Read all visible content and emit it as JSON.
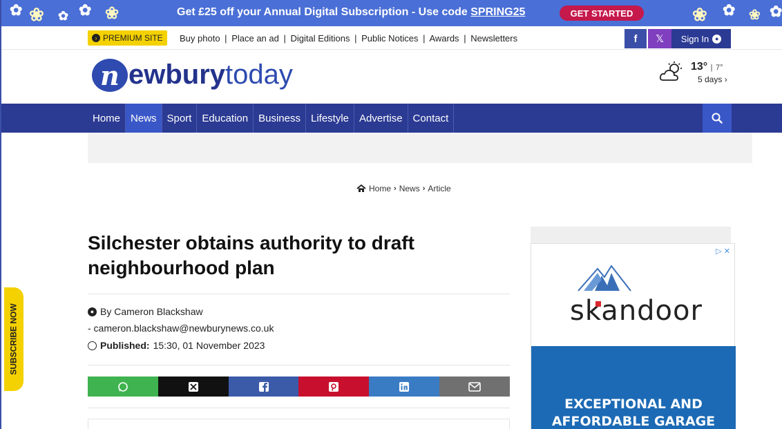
{
  "promo": {
    "text": "Get £25 off your Annual Digital Subscription - Use code ",
    "code": "SPRING25",
    "button": "GET STARTED"
  },
  "utility": {
    "premium_label": "PREMIUM SITE",
    "links": [
      "Buy photo",
      "Place an ad",
      "Digital Editions",
      "Public Notices",
      "Awards",
      "Newsletters"
    ],
    "separator": "|",
    "facebook": "f",
    "x": "𝕏",
    "sign_in": "Sign In"
  },
  "logo": {
    "letter": "n",
    "text_bold": "ewbury",
    "text_light": "today"
  },
  "weather": {
    "high": "13°",
    "low": "7°",
    "divider": "|",
    "forecast_link": "5 days ›",
    "icon": "partly-cloudy-icon"
  },
  "nav": {
    "items": [
      {
        "label": "Home",
        "active": false
      },
      {
        "label": "News",
        "active": true
      },
      {
        "label": "Sport",
        "active": false
      },
      {
        "label": "Education",
        "active": false
      },
      {
        "label": "Business",
        "active": false
      },
      {
        "label": "Lifestyle",
        "active": false
      },
      {
        "label": "Advertise",
        "active": false
      },
      {
        "label": "Contact",
        "active": false
      }
    ],
    "search_icon": "search-icon"
  },
  "breadcrumb": {
    "home": "Home",
    "section": "News",
    "page": "Article"
  },
  "article": {
    "headline": "Silchester obtains authority to draft neighbourhood plan",
    "author": "By Cameron Blackshaw",
    "email": "- cameron.blackshaw@newburynews.co.uk",
    "published_label": "Published:",
    "published_value": "15:30, 01 November 2023"
  },
  "share": [
    {
      "name": "whatsapp",
      "icon": "whatsapp-icon",
      "color": "#3fb34f"
    },
    {
      "name": "x",
      "icon": "x-icon",
      "color": "#111111"
    },
    {
      "name": "facebook",
      "icon": "facebook-icon",
      "color": "#3b5aa8"
    },
    {
      "name": "pinterest",
      "icon": "pinterest-icon",
      "color": "#c8102e"
    },
    {
      "name": "linkedin",
      "icon": "linkedin-icon",
      "color": "#3a7cc4"
    },
    {
      "name": "email",
      "icon": "envelope-icon",
      "color": "#707070"
    }
  ],
  "sidebar_ad": {
    "brand": "skandoor",
    "headline_line1": "EXCEPTIONAL AND",
    "headline_line2": "AFFORDABLE GARAGE",
    "adchoices": "▷ ✕"
  },
  "subscribe_tab": "SUBSCRIBE NOW",
  "colors": {
    "brand_blue": "#2b3a93",
    "promo_blue": "#4a6fd6",
    "promo_button": "#c5184b",
    "premium_yellow": "#f4d100",
    "ad_blue": "#1c6ab5"
  }
}
